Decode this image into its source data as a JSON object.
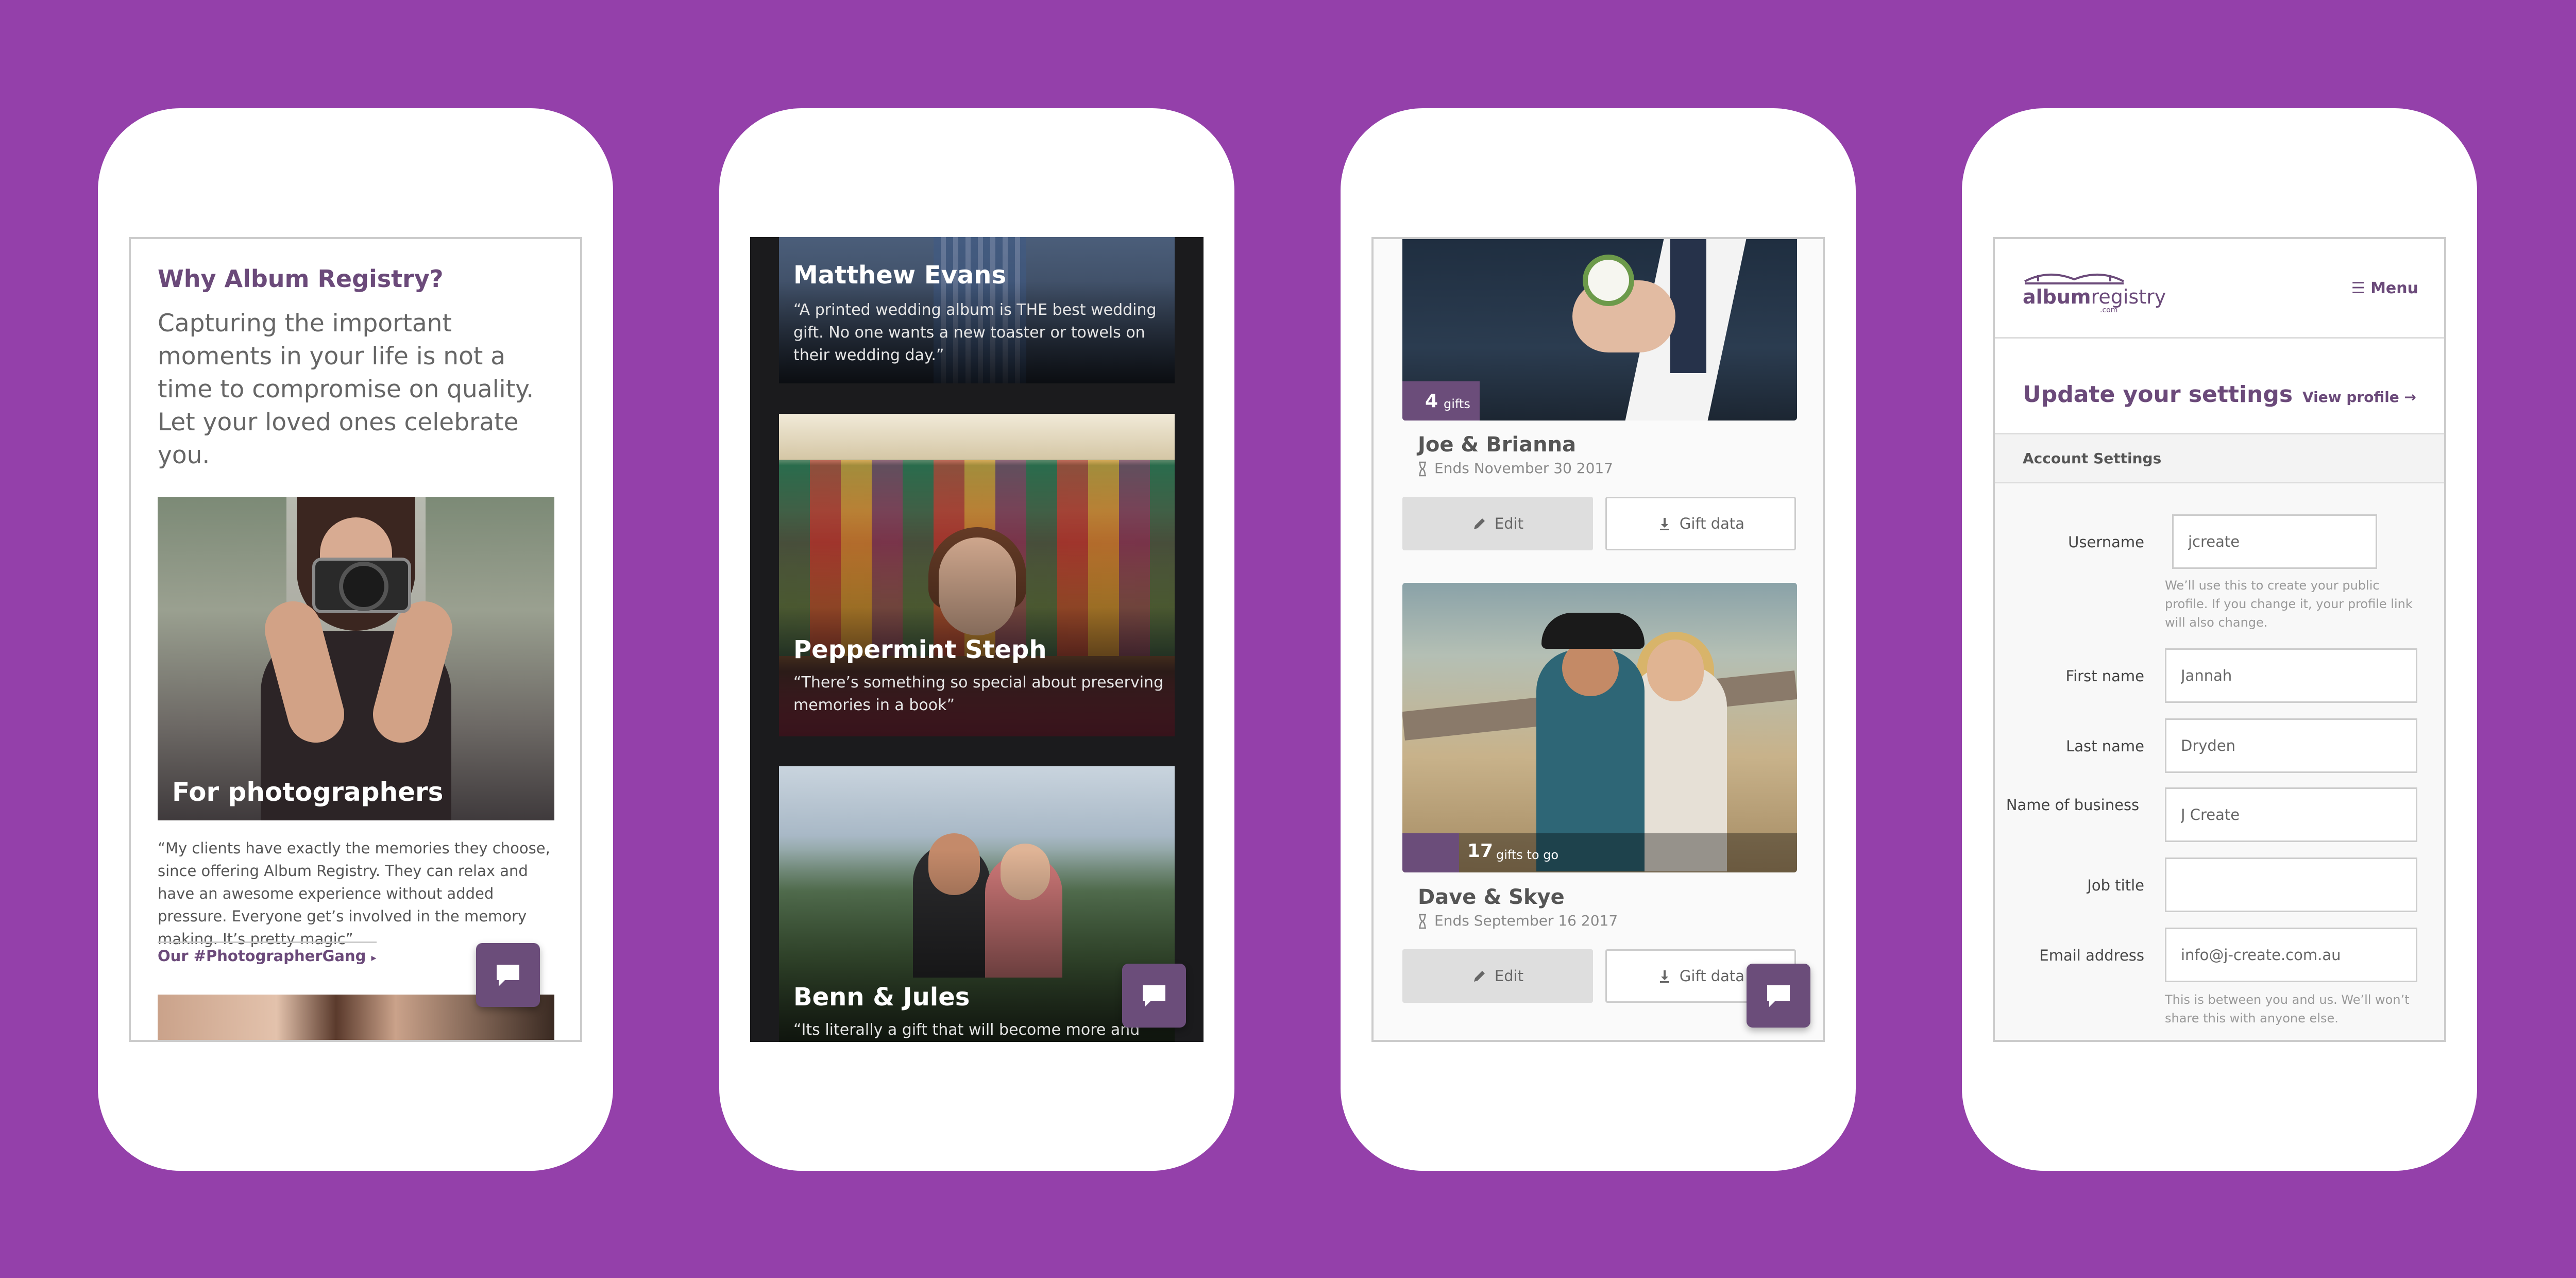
{
  "phone1": {
    "heading": "Why Album Registry?",
    "intro": "Capturing the important moments in your life is not a time to compromise on quality. Let your loved ones celebrate you.",
    "feature_title": "For photographers",
    "quote": "“My clients have exactly the memories they choose, since offering Album Registry. They can relax and have an awesome experience without added pressure. Everyone get’s involved in the memory making. It’s pretty magic”",
    "link_label": "Our #PhotographerGang"
  },
  "phone2": {
    "cards": [
      {
        "name": "Matthew Evans",
        "quote": "“A printed wedding album is THE best wedding gift. No one wants a new toaster or towels on their wedding day.”"
      },
      {
        "name": "Peppermint Steph",
        "quote": "“There’s something so special about preserving memories in a book”"
      },
      {
        "name": "Benn & Jules",
        "quote": "“Its literally a gift that will become more and more"
      }
    ]
  },
  "phone3": {
    "registries": [
      {
        "gift_count": "4",
        "gift_label": "gifts",
        "name": "Joe & Brianna",
        "ends": "Ends November 30 2017",
        "edit_label": "Edit",
        "gift_data_label": "Gift data"
      },
      {
        "gift_count": "17",
        "gift_label": "gifts to go",
        "name": "Dave & Skye",
        "ends": "Ends September 16 2017",
        "edit_label": "Edit",
        "gift_data_label": "Gift data"
      }
    ]
  },
  "phone4": {
    "logo_text_bold": "album",
    "logo_text_light": "registry",
    "logo_sub": ".com",
    "menu_label": "Menu",
    "title": "Update your settings",
    "view_profile_label": "View profile",
    "section_label": "Account Settings",
    "fields": {
      "username": {
        "label": "Username",
        "value": "jcreate",
        "help": "We’ll use this to create your public profile. If you change it, your profile link will also change."
      },
      "first_name": {
        "label": "First name",
        "value": "Jannah"
      },
      "last_name": {
        "label": "Last name",
        "value": "Dryden"
      },
      "business": {
        "label": "Name of business",
        "value": "J Create"
      },
      "job_title": {
        "label": "Job title",
        "value": ""
      },
      "email": {
        "label": "Email address",
        "value": "info@j-create.com.au",
        "help": "This is between you and us. We’ll won’t share this with anyone else."
      }
    }
  },
  "colors": {
    "background": "#9440aa",
    "brand": "#6b4a7a",
    "chat_button": "#6b4d7a"
  },
  "icons": {
    "chat": "speech-bubble-icon",
    "edit": "pencil-icon",
    "download": "download-icon",
    "hourglass": "hourglass-icon",
    "menu": "hamburger-icon"
  }
}
